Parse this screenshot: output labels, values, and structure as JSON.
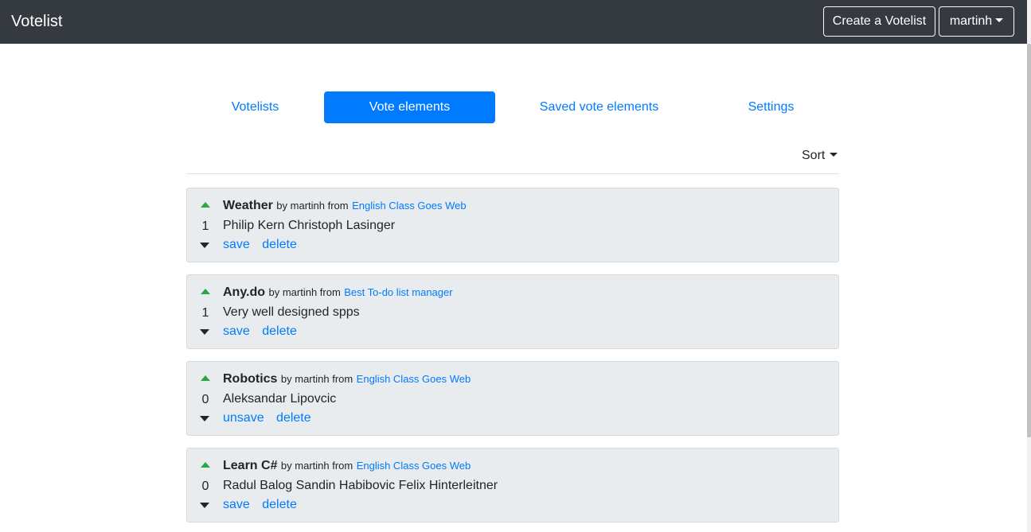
{
  "navbar": {
    "brand": "Votelist",
    "create_button": "Create a Votelist",
    "user_menu": "martinh"
  },
  "tabs": [
    {
      "label": "Votelists",
      "active": false
    },
    {
      "label": "Vote elements",
      "active": true
    },
    {
      "label": "Saved vote elements",
      "active": false
    },
    {
      "label": "Settings",
      "active": false
    }
  ],
  "sort": {
    "label": "Sort"
  },
  "elements": [
    {
      "title": "Weather",
      "by": "by martinh from",
      "source": "English Class Goes Web",
      "score": "1",
      "description": "Philip Kern Christoph Lasinger",
      "save_action": "save",
      "delete_action": "delete"
    },
    {
      "title": "Any.do",
      "by": "by martinh from",
      "source": "Best To-do list manager",
      "score": "1",
      "description": "Very well designed spps",
      "save_action": "save",
      "delete_action": "delete"
    },
    {
      "title": "Robotics",
      "by": "by martinh from",
      "source": "English Class Goes Web",
      "score": "0",
      "description": "Aleksandar Lipovcic",
      "save_action": "unsave",
      "delete_action": "delete"
    },
    {
      "title": "Learn C#",
      "by": "by martinh from",
      "source": "English Class Goes Web",
      "score": "0",
      "description": "Radul Balog Sandin Habibovic Felix Hinterleitner",
      "save_action": "save",
      "delete_action": "delete"
    }
  ],
  "colors": {
    "navbar_bg": "#343a40",
    "primary": "#007bff",
    "upvote": "#28a745",
    "card_bg": "#e9ecef"
  }
}
